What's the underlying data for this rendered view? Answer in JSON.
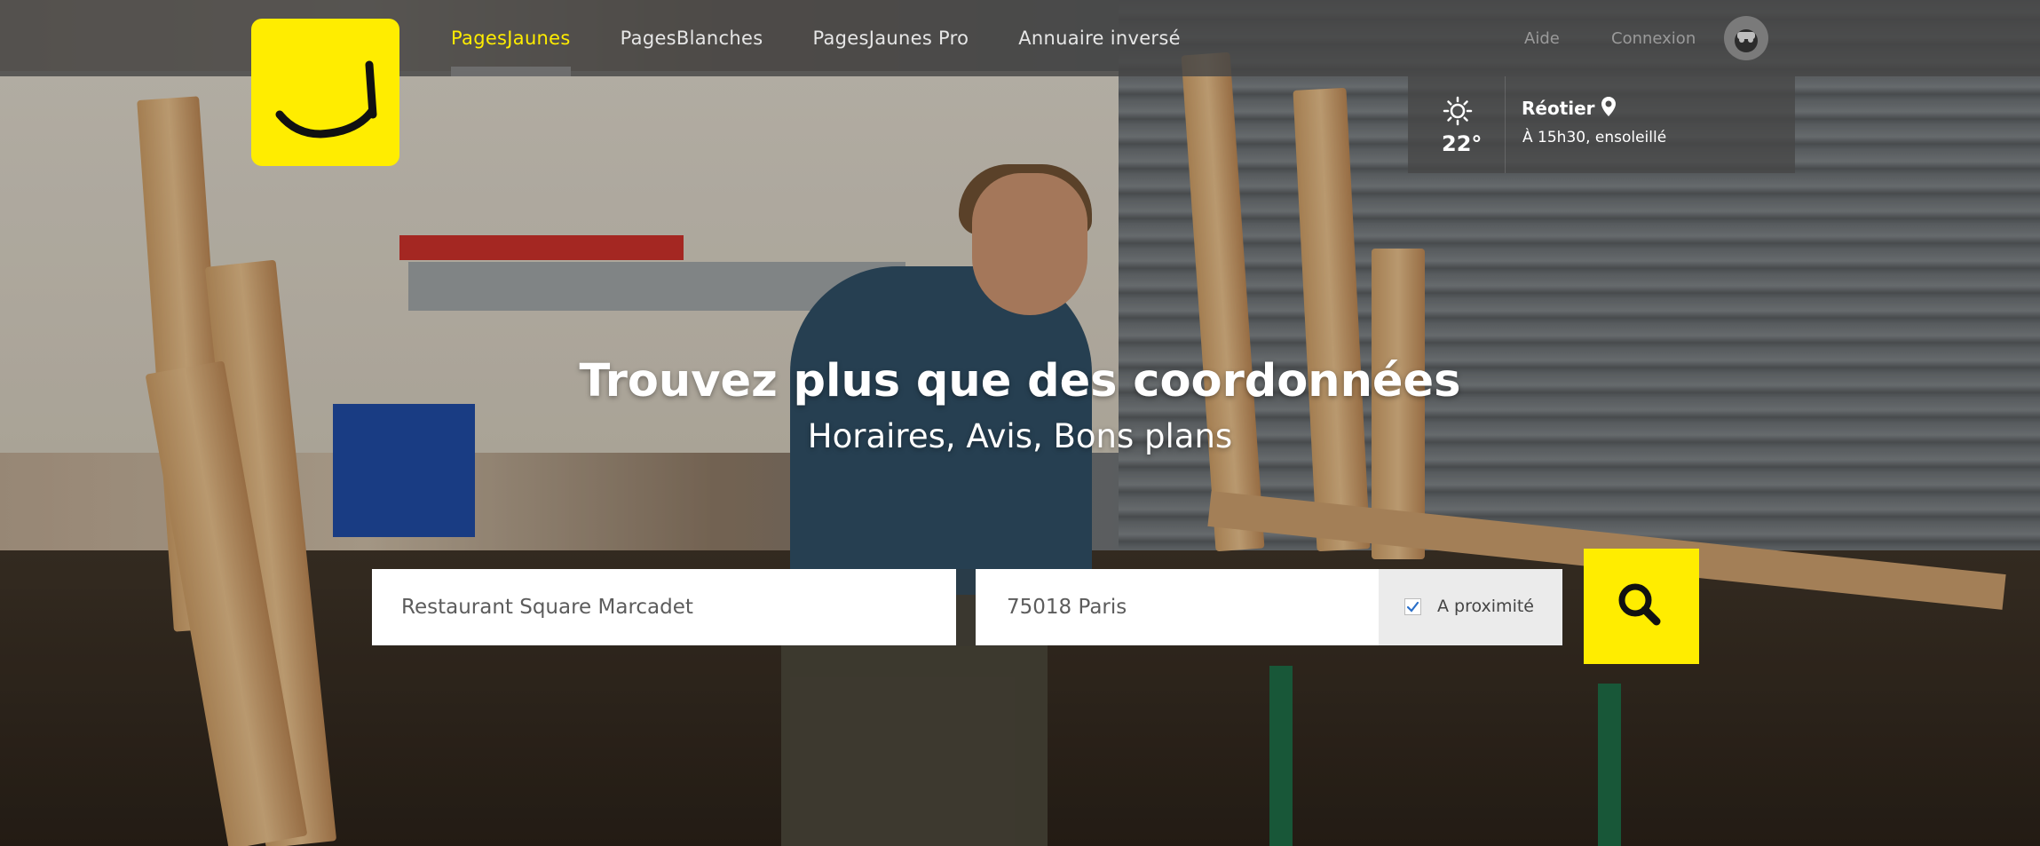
{
  "brand": {
    "logo_icon": "smiley-logo-icon",
    "accent": "#ffed00"
  },
  "nav": {
    "items": [
      {
        "label": "PagesJaunes",
        "active": true
      },
      {
        "label": "PagesBlanches",
        "active": false
      },
      {
        "label": "PagesJaunes Pro",
        "active": false
      },
      {
        "label": "Annuaire inversé",
        "active": false
      }
    ],
    "aide": "Aide",
    "connexion": "Connexion",
    "avatar_icon": "user-avatar-icon"
  },
  "weather": {
    "icon": "sun-icon",
    "temperature": "22°",
    "city": "Réotier",
    "location_icon": "map-pin-icon",
    "forecast": "À 15h30, ensoleillé"
  },
  "hero": {
    "title": "Trouvez plus que des coordonnées",
    "subtitle": "Horaires, Avis, Bons plans"
  },
  "search": {
    "what_value": "Restaurant Square Marcadet",
    "where_value": "75018 Paris",
    "nearby_label": "A proximité",
    "nearby_checked": true,
    "button_icon": "search-icon"
  }
}
